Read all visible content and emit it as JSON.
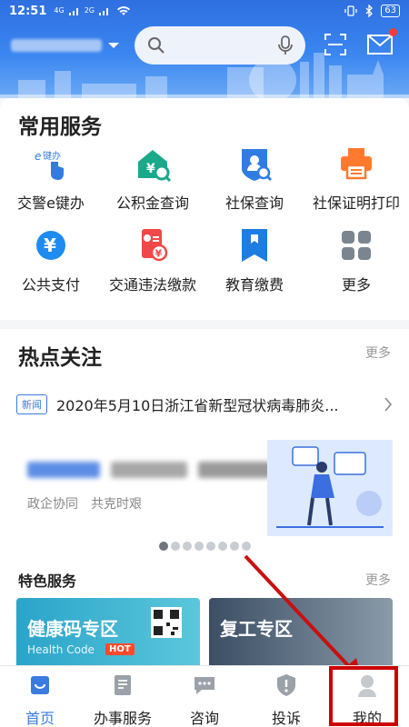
{
  "status_bar": {
    "time": "12:51",
    "net1": "4G",
    "net2": "2G",
    "battery": "63"
  },
  "header": {
    "location_label": "",
    "search_placeholder": ""
  },
  "common_services": {
    "title": "常用服务",
    "items": [
      {
        "label": "交警e键办",
        "icon": "e-key-icon"
      },
      {
        "label": "公积金查询",
        "icon": "housing-fund-icon"
      },
      {
        "label": "社保查询",
        "icon": "social-security-icon"
      },
      {
        "label": "社保证明打印",
        "icon": "printer-icon"
      },
      {
        "label": "公共支付",
        "icon": "yuan-icon"
      },
      {
        "label": "交通违法缴款",
        "icon": "traffic-fine-icon"
      },
      {
        "label": "教育缴费",
        "icon": "bookmark-icon"
      },
      {
        "label": "更多",
        "icon": "grid-icon"
      }
    ]
  },
  "hot_topics": {
    "title": "热点关注",
    "more": "更多",
    "news_tag": "新闻",
    "news_text": "2020年5月10日浙江省新型冠状病毒肺炎...",
    "banner_sub": "政企协同　共克时艰",
    "dots_total": 8,
    "dots_active": 0
  },
  "featured": {
    "title": "特色服务",
    "more": "更多",
    "card1_name": "健康码专区",
    "card1_sub": "Health Code",
    "card1_badge": "HOT",
    "card2_name": "复工专区"
  },
  "tabbar": {
    "items": [
      {
        "label": "首页",
        "active": true
      },
      {
        "label": "办事服务",
        "active": false
      },
      {
        "label": "咨询",
        "active": false
      },
      {
        "label": "投诉",
        "active": false
      },
      {
        "label": "我的",
        "active": false
      }
    ]
  },
  "colors": {
    "primary": "#3a7be0",
    "annotation": "#cc0000"
  }
}
